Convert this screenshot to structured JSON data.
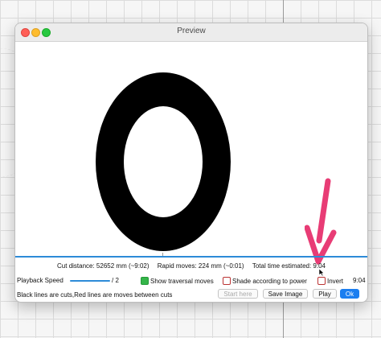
{
  "window": {
    "title": "Preview"
  },
  "stats": {
    "cut_distance": "Cut distance: 52652 mm (~9:02)",
    "rapid_moves": "Rapid moves: 224 mm (~0:01)",
    "total_time": "Total time estimated: 9:04"
  },
  "controls": {
    "playback_speed_label": "Playback Speed",
    "playback_speed_value": "/ 2",
    "show_traversal_label": "Show traversal moves",
    "show_traversal_checked": true,
    "shade_power_label": "Shade according to power",
    "shade_power_checked": false,
    "invert_label": "Invert",
    "invert_checked": false,
    "time_display": "9:04"
  },
  "footer": {
    "legend": "Black lines are cuts,Red lines are moves between cuts",
    "start_here_label": "Start here",
    "save_image_label": "Save Image",
    "play_label": "Play",
    "ok_label": "Ok"
  },
  "colors": {
    "accent": "#2d8bd8",
    "ok_button": "#1b7ef0",
    "arrow": "#e83c75",
    "checkbox_on": "#35b54a",
    "ring": "#000000"
  }
}
